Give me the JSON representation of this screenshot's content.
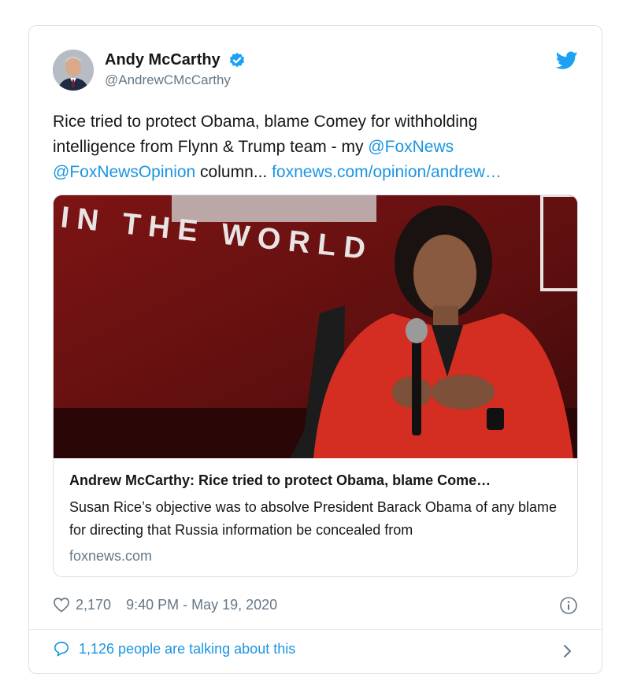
{
  "author": {
    "display_name": "Andy McCarthy",
    "handle": "@AndrewCMcCarthy",
    "verified": true
  },
  "tweet": {
    "text_part1": "Rice tried to protect Obama, blame Comey for withholding intelligence from Flynn & Trump team - my ",
    "mention1": "@FoxNews",
    "mention2": "@FoxNewsOpinion",
    "text_part2": " column... ",
    "url": "foxnews.com/opinion/andrew…"
  },
  "card": {
    "image_caption_text": "IN THE WORLD",
    "title": "Andrew McCarthy: Rice tried to protect Obama, blame Come…",
    "description": "Susan Rice’s objective was to absolve President Barack Obama of any blame for directing that Russia information be concealed from",
    "domain": "foxnews.com"
  },
  "meta": {
    "likes": "2,170",
    "timestamp": "9:40 PM - May 19, 2020"
  },
  "footer": {
    "talking_text": "1,126 people are talking about this"
  },
  "icons": {
    "verified": "verified-badge-icon",
    "bird": "twitter-bird-icon",
    "heart": "heart-icon",
    "info": "info-icon",
    "bubble": "speech-bubble-icon",
    "chevron": "chevron-right-icon"
  },
  "colors": {
    "link": "#1b95e0",
    "secondary_text": "#657786",
    "border": "#dbe1e6",
    "card_photo_bg": "#6e1212",
    "jacket": "#d42d22"
  }
}
